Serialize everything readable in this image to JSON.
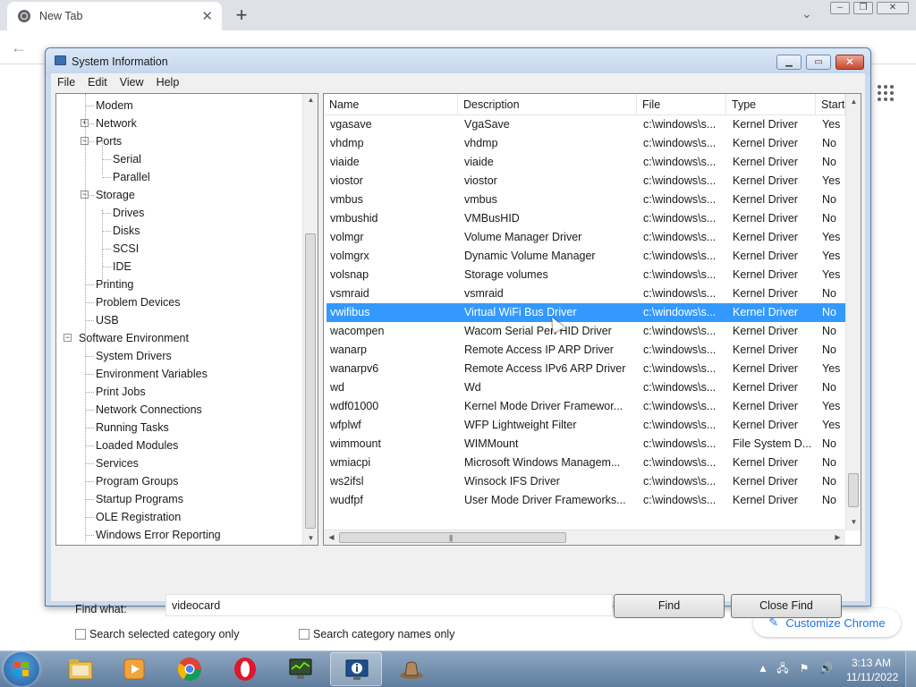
{
  "browser": {
    "tab_title": "New Tab",
    "new_tab_symbol": "+",
    "customize_label": "Customize Chrome"
  },
  "window": {
    "title": "System Information",
    "menu": [
      "File",
      "Edit",
      "View",
      "Help"
    ]
  },
  "tree": {
    "items": [
      {
        "label": "Modem",
        "level": 2,
        "expander": ""
      },
      {
        "label": "Network",
        "level": 2,
        "expander": "+"
      },
      {
        "label": "Ports",
        "level": 2,
        "expander": "-"
      },
      {
        "label": "Serial",
        "level": 3,
        "expander": ""
      },
      {
        "label": "Parallel",
        "level": 3,
        "expander": ""
      },
      {
        "label": "Storage",
        "level": 2,
        "expander": "-"
      },
      {
        "label": "Drives",
        "level": 3,
        "expander": ""
      },
      {
        "label": "Disks",
        "level": 3,
        "expander": ""
      },
      {
        "label": "SCSI",
        "level": 3,
        "expander": ""
      },
      {
        "label": "IDE",
        "level": 3,
        "expander": ""
      },
      {
        "label": "Printing",
        "level": 2,
        "expander": ""
      },
      {
        "label": "Problem Devices",
        "level": 2,
        "expander": ""
      },
      {
        "label": "USB",
        "level": 2,
        "expander": ""
      },
      {
        "label": "Software Environment",
        "level": 1,
        "expander": "-"
      },
      {
        "label": "System Drivers",
        "level": 2,
        "expander": ""
      },
      {
        "label": "Environment Variables",
        "level": 2,
        "expander": ""
      },
      {
        "label": "Print Jobs",
        "level": 2,
        "expander": ""
      },
      {
        "label": "Network Connections",
        "level": 2,
        "expander": ""
      },
      {
        "label": "Running Tasks",
        "level": 2,
        "expander": ""
      },
      {
        "label": "Loaded Modules",
        "level": 2,
        "expander": ""
      },
      {
        "label": "Services",
        "level": 2,
        "expander": ""
      },
      {
        "label": "Program Groups",
        "level": 2,
        "expander": ""
      },
      {
        "label": "Startup Programs",
        "level": 2,
        "expander": ""
      },
      {
        "label": "OLE Registration",
        "level": 2,
        "expander": ""
      },
      {
        "label": "Windows Error Reporting",
        "level": 2,
        "expander": ""
      }
    ]
  },
  "list": {
    "columns": [
      "Name",
      "Description",
      "File",
      "Type",
      "Start"
    ],
    "selected_name": "vwifibus",
    "rows": [
      [
        "vgasave",
        "VgaSave",
        "c:\\windows\\s...",
        "Kernel Driver",
        "Yes"
      ],
      [
        "vhdmp",
        "vhdmp",
        "c:\\windows\\s...",
        "Kernel Driver",
        "No"
      ],
      [
        "viaide",
        "viaide",
        "c:\\windows\\s...",
        "Kernel Driver",
        "No"
      ],
      [
        "viostor",
        "viostor",
        "c:\\windows\\s...",
        "Kernel Driver",
        "Yes"
      ],
      [
        "vmbus",
        "vmbus",
        "c:\\windows\\s...",
        "Kernel Driver",
        "No"
      ],
      [
        "vmbushid",
        "VMBusHID",
        "c:\\windows\\s...",
        "Kernel Driver",
        "No"
      ],
      [
        "volmgr",
        "Volume Manager Driver",
        "c:\\windows\\s...",
        "Kernel Driver",
        "Yes"
      ],
      [
        "volmgrx",
        "Dynamic Volume Manager",
        "c:\\windows\\s...",
        "Kernel Driver",
        "Yes"
      ],
      [
        "volsnap",
        "Storage volumes",
        "c:\\windows\\s...",
        "Kernel Driver",
        "Yes"
      ],
      [
        "vsmraid",
        "vsmraid",
        "c:\\windows\\s...",
        "Kernel Driver",
        "No"
      ],
      [
        "vwifibus",
        "Virtual WiFi Bus Driver",
        "c:\\windows\\s...",
        "Kernel Driver",
        "No"
      ],
      [
        "wacompen",
        "Wacom Serial Pen HID Driver",
        "c:\\windows\\s...",
        "Kernel Driver",
        "No"
      ],
      [
        "wanarp",
        "Remote Access IP ARP Driver",
        "c:\\windows\\s...",
        "Kernel Driver",
        "No"
      ],
      [
        "wanarpv6",
        "Remote Access IPv6 ARP Driver",
        "c:\\windows\\s...",
        "Kernel Driver",
        "Yes"
      ],
      [
        "wd",
        "Wd",
        "c:\\windows\\s...",
        "Kernel Driver",
        "No"
      ],
      [
        "wdf01000",
        "Kernel Mode Driver Framewor...",
        "c:\\windows\\s...",
        "Kernel Driver",
        "Yes"
      ],
      [
        "wfplwf",
        "WFP Lightweight Filter",
        "c:\\windows\\s...",
        "Kernel Driver",
        "Yes"
      ],
      [
        "wimmount",
        "WIMMount",
        "c:\\windows\\s...",
        "File System D...",
        "No"
      ],
      [
        "wmiacpi",
        "Microsoft Windows Managem...",
        "c:\\windows\\s...",
        "Kernel Driver",
        "No"
      ],
      [
        "ws2ifsl",
        "Winsock IFS Driver",
        "c:\\windows\\s...",
        "Kernel Driver",
        "No"
      ],
      [
        "wudfpf",
        "User Mode Driver Frameworks...",
        "c:\\windows\\s...",
        "Kernel Driver",
        "No"
      ]
    ]
  },
  "find": {
    "label": "Find what:",
    "value": "videocard",
    "find_button": "Find",
    "close_button": "Close Find",
    "check_selected": "Search selected category only",
    "check_names": "Search category names only"
  },
  "taskbar": {
    "apps": [
      "file-explorer",
      "media-player",
      "chrome",
      "opera",
      "system-monitor",
      "system-information",
      "task-app"
    ],
    "time": "3:13 AM",
    "date": "11/11/2022"
  },
  "colors": {
    "selection": "#3399ff",
    "customize_text": "#1a73e8",
    "taskbar": "#6b88a8"
  }
}
